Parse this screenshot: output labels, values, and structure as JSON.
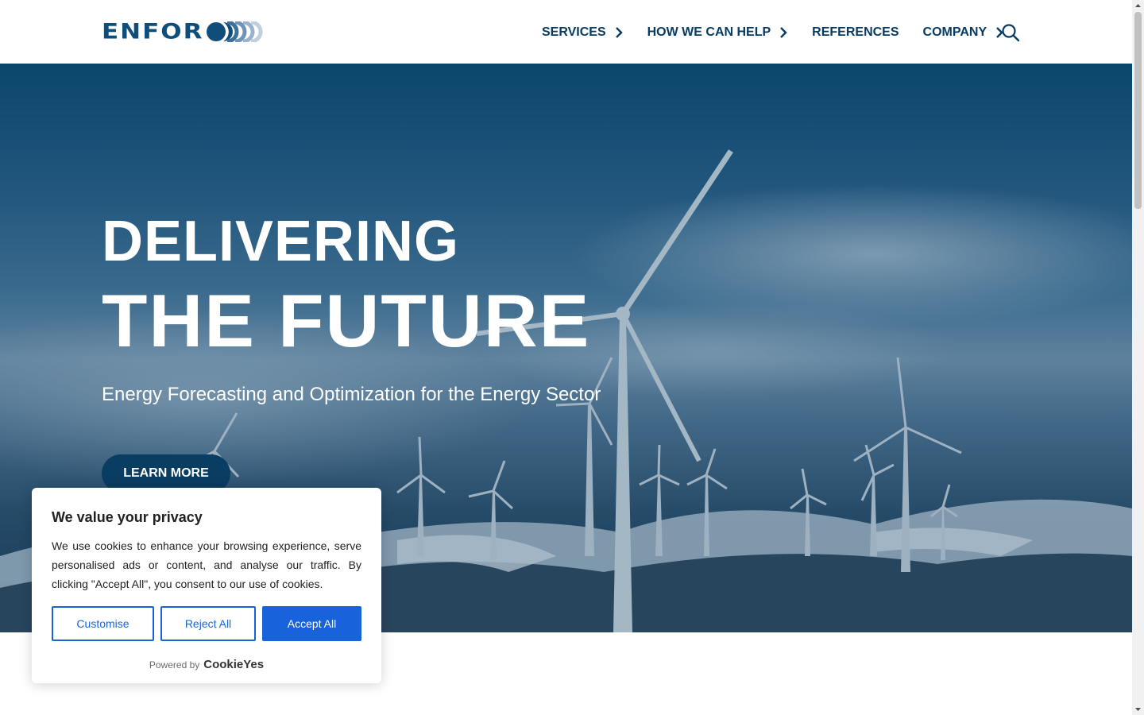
{
  "header": {
    "logo_text": "ENFOR",
    "nav": [
      {
        "label": "SERVICES",
        "has_chevron": true
      },
      {
        "label": "HOW WE CAN HELP",
        "has_chevron": true
      },
      {
        "label": "REFERENCES",
        "has_chevron": false
      },
      {
        "label": "COMPANY",
        "has_chevron": true
      }
    ],
    "search_icon": "search-icon"
  },
  "hero": {
    "title_line1": "DELIVERING",
    "title_line2": "THE FUTURE",
    "subtitle": "Energy Forecasting and Optimization for the Energy Sector",
    "cta_label": "LEARN MORE"
  },
  "cookie_banner": {
    "title": "We value your privacy",
    "text": "We use cookies to enhance your browsing experience, serve personalised ads or content, and analyse our traffic. By clicking \"Accept All\", you consent to our use of cookies.",
    "customise_label": "Customise",
    "reject_label": "Reject All",
    "accept_label": "Accept All",
    "powered_by": "Powered by",
    "powered_brand": "CookieYes"
  },
  "colors": {
    "brand_navy": "#073b63",
    "logo_blue": "#0f4d7a",
    "cookie_blue": "#1863dc",
    "cta_bg": "#0a3d62"
  }
}
